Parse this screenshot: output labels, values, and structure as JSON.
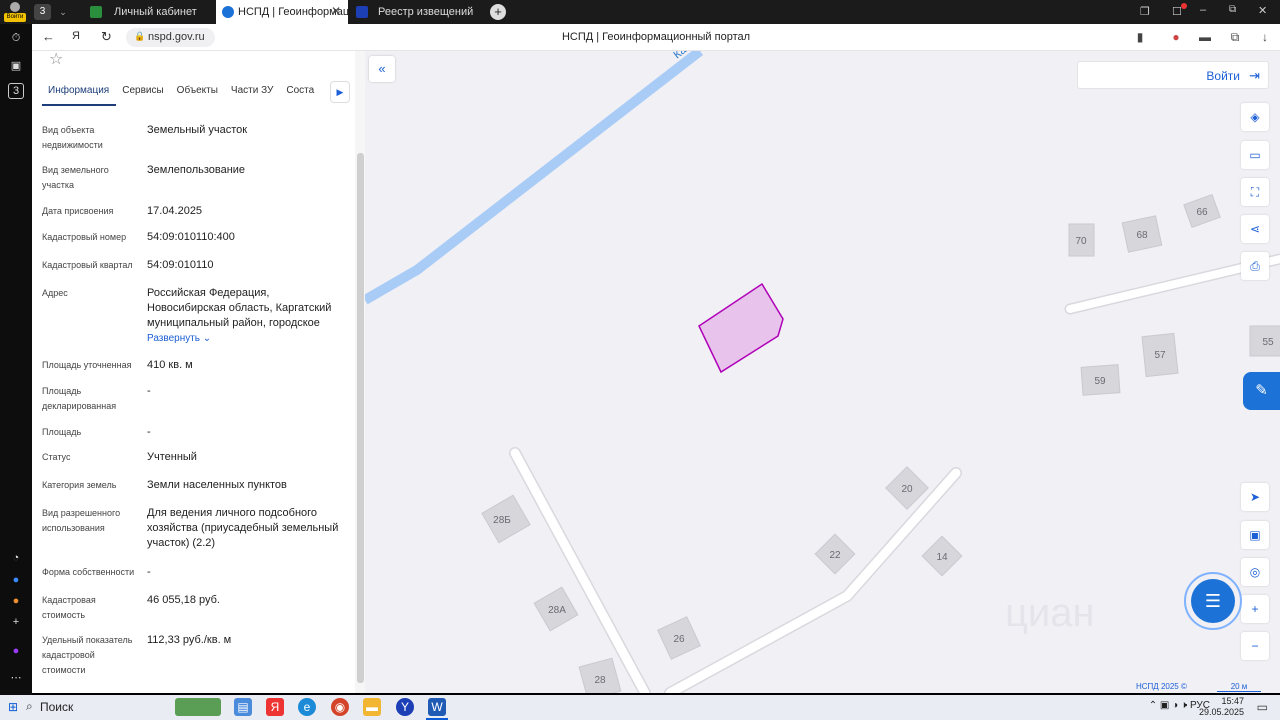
{
  "browser": {
    "profile_label": "Войти",
    "tab_count": "3",
    "tabs": [
      {
        "title": "Личный кабинет",
        "active": false,
        "icon_color": "#2a8f3d"
      },
      {
        "title": "НСПД | Геоинформацио",
        "active": true,
        "icon_color": "#1c72d6"
      },
      {
        "title": "Реестр извещений",
        "active": false,
        "icon_color": "#1c3fb5"
      }
    ],
    "address": "nspd.gov.ru",
    "page_title": "НСПД | Геоинформационный портал"
  },
  "sidebar": {
    "counter": "3"
  },
  "panel": {
    "tabs": [
      "Информация",
      "Сервисы",
      "Объекты",
      "Части ЗУ",
      "Соста"
    ],
    "expand_label": "Развернуть",
    "rows": [
      {
        "label": "Вид объекта недвижимости",
        "value": "Земельный участок"
      },
      {
        "label": "Вид земельного участка",
        "value": "Землепользование"
      },
      {
        "label": "Дата присвоения",
        "value": "17.04.2025"
      },
      {
        "label": "Кадастровый номер",
        "value": "54:09:010110:400"
      },
      {
        "label": "Кадастровый квартал",
        "value": "54:09:010110"
      },
      {
        "label": "Адрес",
        "value": "Российская Федерация, Новосибирская область, Каргатский муниципальный район, городское"
      },
      {
        "label": "Площадь уточненная",
        "value": "410 кв. м"
      },
      {
        "label": "Площадь декларированная",
        "value": "-"
      },
      {
        "label": "Площадь",
        "value": "-"
      },
      {
        "label": "Статус",
        "value": "Учтенный"
      },
      {
        "label": "Категория земель",
        "value": "Земли населенных пунктов"
      },
      {
        "label": "Вид разрешенного использования",
        "value": "Для ведения личного подсобного хозяйства (приусадебный земельный участок) (2.2)"
      },
      {
        "label": "Форма собственности",
        "value": "-"
      },
      {
        "label": "Кадастровая стоимость",
        "value": "46 055,18 руб."
      },
      {
        "label": "Удельный показатель кадастровой стоимости",
        "value": "112,33 руб./кв. м"
      }
    ]
  },
  "map": {
    "login_label": "Войти",
    "road_label": "Ка",
    "house_numbers": [
      "70",
      "68",
      "66",
      "57",
      "59",
      "55",
      "20",
      "22",
      "14",
      "28Б",
      "28А",
      "26",
      "28"
    ],
    "footer": "НСПД 2025 ©",
    "scale_label": "20 м",
    "watermark": "циан",
    "parcel_color": "#b000b8"
  },
  "taskbar": {
    "search_label": "Поиск",
    "language": "РУС",
    "time": "15:47",
    "date": "29.05.2025"
  }
}
